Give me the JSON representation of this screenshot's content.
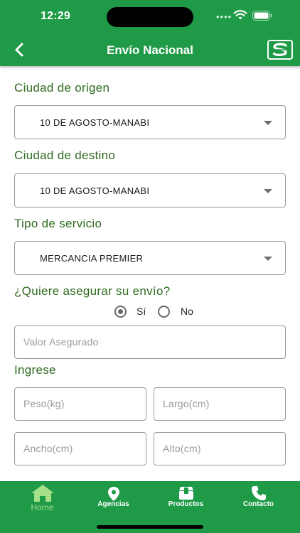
{
  "status_bar": {
    "time": "12:29",
    "signal": "••••"
  },
  "header": {
    "title": "Envío Nacional"
  },
  "form": {
    "origin_label": "Ciudad de origen",
    "origin_value": "10 DE AGOSTO-MANABI",
    "destination_label": "Ciudad de destino",
    "destination_value": "10 DE AGOSTO-MANABI",
    "service_label": "Tipo de servicio",
    "service_value": "MERCANCIA PREMIER",
    "insure_question": "¿Quiere asegurar su envío?",
    "insure_yes": "Sí",
    "insure_no": "No",
    "insure_selected": "Sí",
    "insured_value_placeholder": "Valor Asegurado",
    "ingrese_label": "Ingrese",
    "weight_placeholder": "Peso(kg)",
    "length_placeholder": "Largo(cm)",
    "width_placeholder": "Ancho(cm)",
    "height_placeholder": "Alto(cm)"
  },
  "tabbar": {
    "home": "Home",
    "agencies": "Agencias",
    "products": "Productos",
    "contact": "Contacto",
    "active": "Home"
  },
  "colors": {
    "brand_green": "#1f9a47",
    "label_green": "#2f6b20",
    "active_tab": "#a6e08a"
  }
}
